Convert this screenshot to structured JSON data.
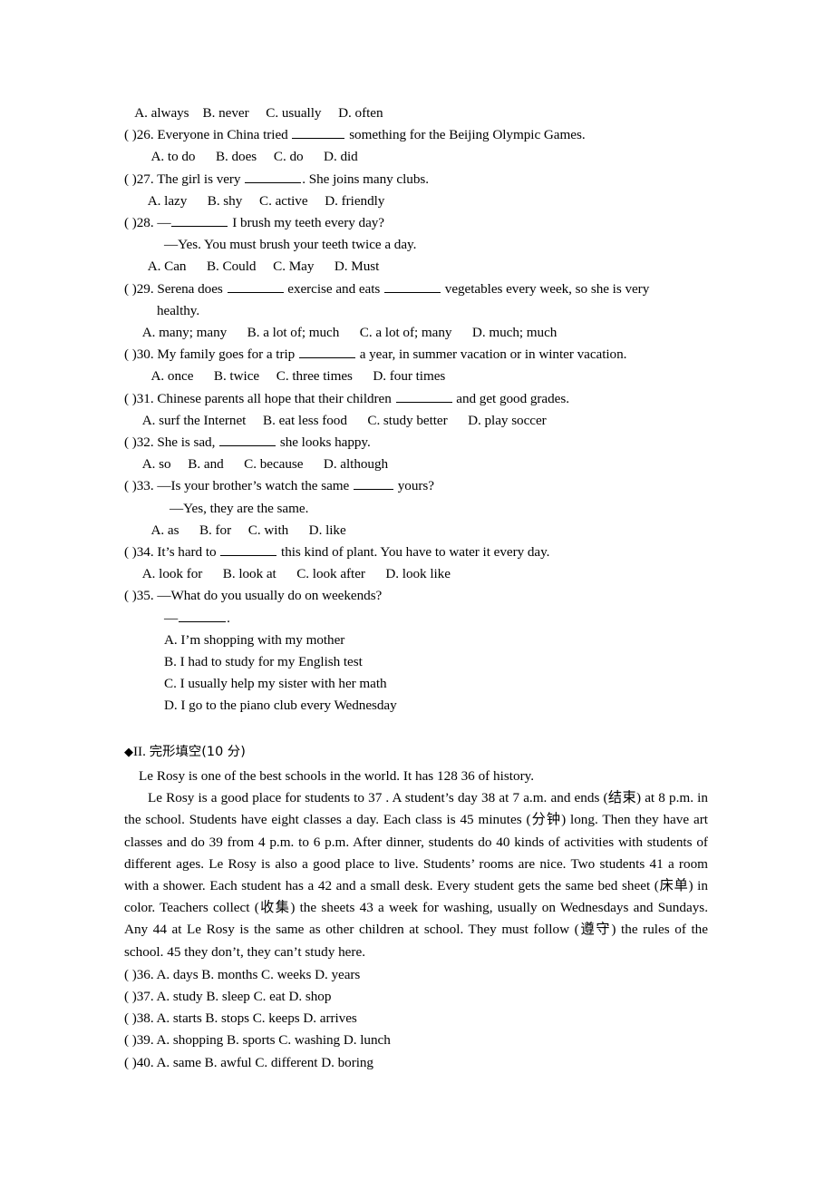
{
  "document": {
    "section_1": {
      "q25_options": "   A. always    B. never     C. usually     D. often",
      "questions": [
        {
          "id": "q26",
          "stem_pre": "( )26. Everyone in China tried ",
          "stem_post": " something for the Beijing Olympic Games.",
          "blank": "b-l",
          "options": "  A. to do      B. does     C. do      D. did"
        },
        {
          "id": "q27",
          "stem_pre": "( )27. The girl is very ",
          "stem_post": ". She joins many clubs.",
          "blank": "b-xl",
          "options": " A. lazy      B. shy     C. active     D. friendly"
        },
        {
          "id": "q28",
          "stem_pre": "( )28. —",
          "stem_post": " I brush my teeth every day?",
          "blank": "b-xl",
          "dialogue": "—Yes. You must brush your teeth twice a day.",
          "options": " A. Can      B. Could     C. May      D. Must"
        },
        {
          "id": "q29",
          "stem_pre": "( )29. Serena does ",
          "stem_mid": " exercise and eats ",
          "stem_post": " vegetables every week, so she is very",
          "blank": "b-xl",
          "blank2": "b-xl",
          "wrap": "healthy.",
          "options": " A. many; many      B. a lot of; much      C. a lot of; many      D. much; much"
        },
        {
          "id": "q30",
          "stem_pre": "( )30. My family goes for a trip ",
          "stem_post": " a year, in summer vacation or in winter vacation.",
          "blank": "b-xl",
          "options": "  A. once      B. twice     C. three times      D. four times"
        },
        {
          "id": "q31",
          "stem_pre": "( )31. Chinese parents all hope that their children ",
          "stem_post": " and get good grades.",
          "blank": "b-xl",
          "options": " A. surf the Internet     B. eat less food      C. study better      D. play soccer"
        },
        {
          "id": "q32",
          "stem_pre": "( )32. She is sad, ",
          "stem_post": " she looks happy.",
          "blank": "b-xl",
          "options": " A. so     B. and      C. because      D. although"
        },
        {
          "id": "q33",
          "stem_pre": "( )33. —Is your brother’s watch the same ",
          "stem_post": " yours?",
          "blank": "b-s",
          "dialogue": "—Yes, they are the same.",
          "options": "  A. as      B. for     C. with      D. like"
        },
        {
          "id": "q34",
          "stem_pre": "( )34. It’s hard to ",
          "stem_post": " this kind of plant. You have to water it every day.",
          "blank": "b-xl",
          "options": " A. look for      B. look at      C. look after      D. look like"
        },
        {
          "id": "q35",
          "stem_pre": "( )35. —What do you usually do on weekends?",
          "answer_dash_pre": "—",
          "answer_dash_post": ".",
          "blank": "b-m",
          "choices": [
            "A. I’m shopping with my mother",
            "B. I had to study for my English test",
            "C. I usually help my sister with her math",
            "D. I go to the piano club every Wednesday"
          ]
        }
      ]
    },
    "section_2": {
      "heading_diamond": "◆",
      "heading_roman": "II.",
      "heading_cjk": "完形填空",
      "heading_score": "(10 分)",
      "passage_p1": "Le Rosy is one of the best schools in the world. It has 128 36 of history.",
      "passage_p2": "Le Rosy is a good place for students to 37 . A student’s day 38 at 7 a.m. and ends (结束) at 8 p.m. in the school. Students have eight classes a day. Each class is 45 minutes (分钟) long. Then they have art classes and do 39 from 4 p.m. to 6 p.m. After dinner, students do 40 kinds of activities with students of different ages. Le Rosy is also a good place to live. Students’ rooms are nice. Two students 41 a room with a shower. Each student has a 42 and a small desk. Every student gets the same bed sheet (床单) in color. Teachers collect (收集) the sheets 43 a week for washing, usually on Wednesdays and Sundays. Any 44 at Le Rosy is the same as other children at school. They must follow (遵守) the rules of the school. 45 they don’t, they can’t study here.",
      "answer_lines": [
        "( )36. A. days B. months C. weeks D. years",
        "( )37. A. study B. sleep C. eat D. shop",
        "( )38. A. starts B. stops C. keeps D. arrives",
        "( )39. A. shopping B. sports C. washing D. lunch",
        "( )40. A. same B. awful C. different D. boring"
      ]
    }
  }
}
